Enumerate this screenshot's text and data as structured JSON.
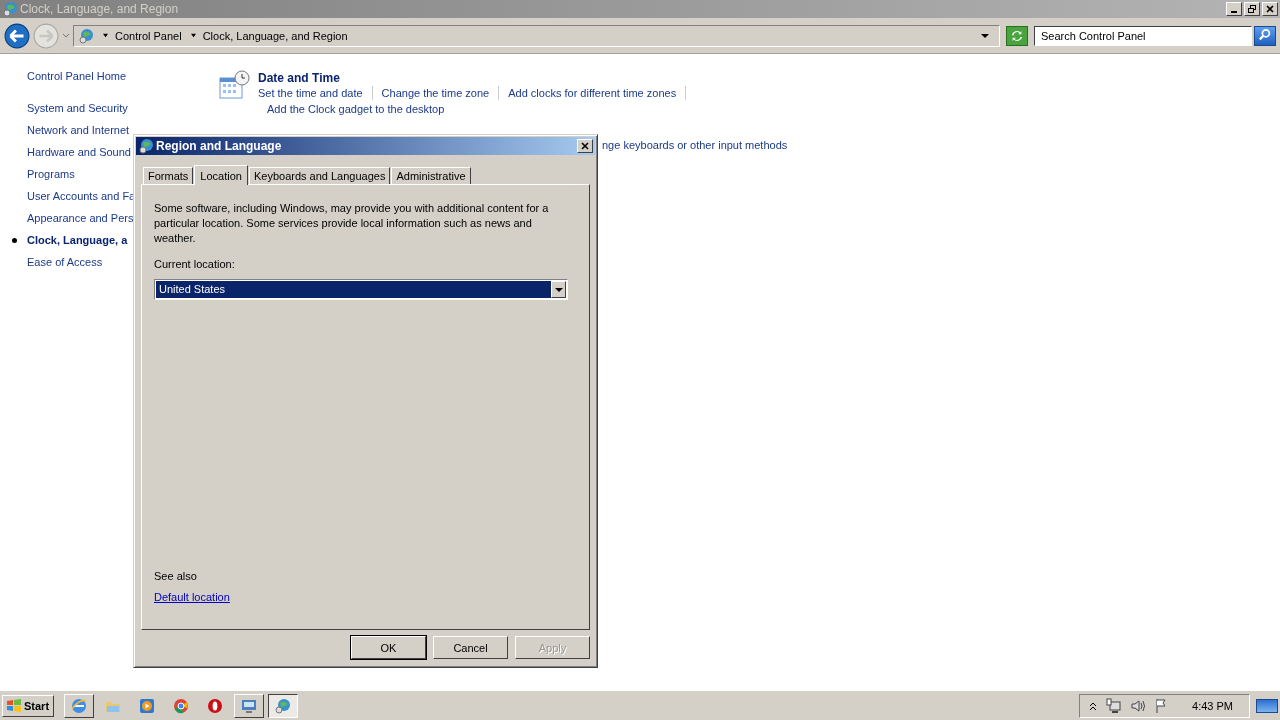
{
  "window": {
    "title": "Clock, Language, and Region"
  },
  "address_bar": {
    "breadcrumbs": [
      "Control Panel",
      "Clock, Language, and Region"
    ]
  },
  "search": {
    "placeholder": "Search Control Panel"
  },
  "sidebar": {
    "home": "Control Panel Home",
    "items": [
      {
        "label": "System and Security",
        "selected": false
      },
      {
        "label": "Network and Internet",
        "selected": false
      },
      {
        "label": "Hardware and Sound",
        "selected": false
      },
      {
        "label": "Programs",
        "selected": false
      },
      {
        "label": "User Accounts and Fa",
        "selected": false
      },
      {
        "label": "Appearance and Pers",
        "selected": false
      },
      {
        "label": "Clock, Language, a",
        "selected": true
      },
      {
        "label": "Ease of Access",
        "selected": false
      }
    ]
  },
  "categories": [
    {
      "title": "Date and Time",
      "links": [
        "Set the time and date",
        "Change the time zone",
        "Add clocks for different time zones",
        "Add the Clock gadget to the desktop"
      ]
    },
    {
      "links": [
        "nge keyboards or other input methods"
      ]
    }
  ],
  "dialog": {
    "title": "Region and Language",
    "tabs": [
      {
        "label": "Formats",
        "selected": false
      },
      {
        "label": "Location",
        "selected": true
      },
      {
        "label": "Keyboards and Languages",
        "selected": false
      },
      {
        "label": "Administrative",
        "selected": false
      }
    ],
    "description": "Some software, including Windows, may provide you with additional content for a particular location. Some services provide local information such as news and weather.",
    "location_label": "Current location:",
    "location_value": "United States",
    "see_also": "See also",
    "link": "Default location",
    "buttons": [
      {
        "label": "OK",
        "disabled": false
      },
      {
        "label": "Cancel",
        "disabled": false
      },
      {
        "label": "Apply",
        "disabled": true
      }
    ]
  },
  "taskbar": {
    "start": "Start",
    "apps": [
      {
        "kind": "browser",
        "selected": false
      },
      {
        "kind": "folder",
        "selected": false
      },
      {
        "kind": "media",
        "selected": false
      },
      {
        "kind": "chrome",
        "selected": false
      },
      {
        "kind": "opera",
        "selected": false
      },
      {
        "kind": "remote",
        "selected": false
      },
      {
        "kind": "control",
        "selected": true
      }
    ],
    "clock": "4:43 PM"
  }
}
